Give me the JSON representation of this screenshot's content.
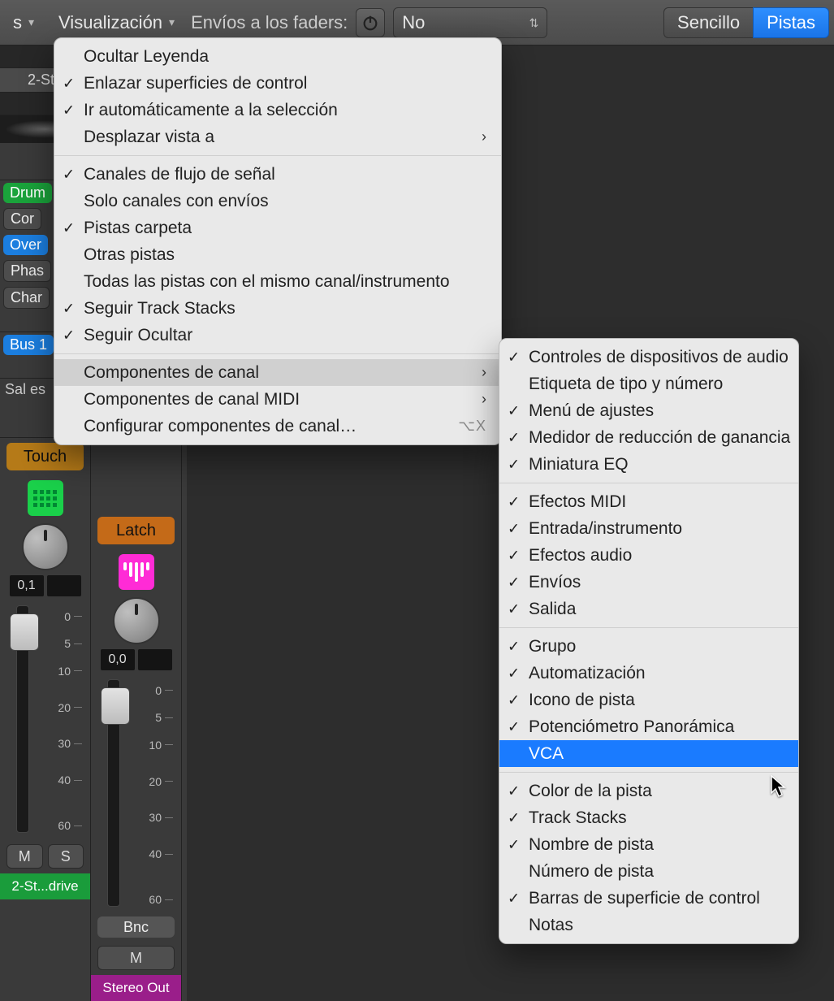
{
  "toolbar": {
    "left_partial": "s",
    "visualizacion": "Visualización",
    "sends_label": "Envíos a los faders:",
    "sends_value": "No",
    "simple": "Sencillo",
    "tracks": "Pistas"
  },
  "strip1": {
    "title": "2-Ste",
    "drum": "Drum",
    "cor": "Cor",
    "over": "Over",
    "phas": "Phas",
    "char": "Char",
    "bus": "Bus 1",
    "out": "Sal es",
    "automode": "Touch",
    "panval": "0,1",
    "m": "M",
    "s": "S",
    "name": "2-St...drive"
  },
  "strip2": {
    "automode": "Latch",
    "panval": "0,0",
    "bnc": "Bnc",
    "m": "M",
    "name": "Stereo Out"
  },
  "scale": {
    "t0": "0",
    "t5": "5",
    "t10": "10",
    "t20": "20",
    "t30": "30",
    "t40": "40",
    "t60": "60"
  },
  "menu1": {
    "ocultar": "Ocultar Leyenda",
    "enlazar": "Enlazar superficies de control",
    "irauto": "Ir automáticamente a la selección",
    "desplazar": "Desplazar vista a",
    "canales": "Canales de flujo de señal",
    "solo": "Solo canales con envíos",
    "carpeta": "Pistas carpeta",
    "otras": "Otras pistas",
    "todas": "Todas las pistas con el mismo canal/instrumento",
    "trackstacks": "Seguir Track Stacks",
    "ocultar2": "Seguir Ocultar",
    "comp": "Componentes de canal",
    "compmidi": "Componentes de canal MIDI",
    "config": "Configurar componentes de canal…",
    "shortcut": "⌥X"
  },
  "menu2": {
    "a1": "Controles de dispositivos de audio",
    "a2": "Etiqueta de tipo y número",
    "a3": "Menú de ajustes",
    "a4": "Medidor de reducción de ganancia",
    "a5": "Miniatura EQ",
    "b1": "Efectos MIDI",
    "b2": "Entrada/instrumento",
    "b3": "Efectos audio",
    "b4": "Envíos",
    "b5": "Salida",
    "c1": "Grupo",
    "c2": "Automatización",
    "c3": "Icono de pista",
    "c4": "Potenciómetro Panorámica",
    "c5": "VCA",
    "d1": "Color de la pista",
    "d2": "Track Stacks",
    "d3": "Nombre de pista",
    "d4": "Número de pista",
    "d5": "Barras de superficie de control",
    "d6": "Notas"
  }
}
